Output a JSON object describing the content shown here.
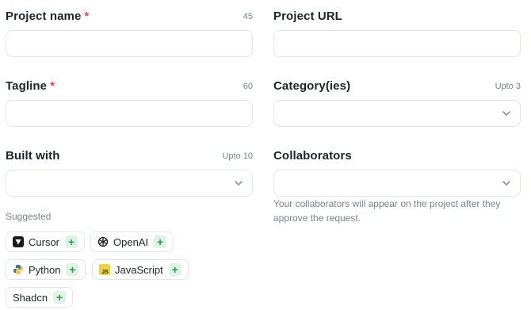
{
  "left": {
    "project_name": {
      "label": "Project name",
      "required_mark": "*",
      "counter": "45",
      "value": ""
    },
    "tagline": {
      "label": "Tagline",
      "required_mark": "*",
      "counter": "60",
      "value": ""
    },
    "built_with": {
      "label": "Built with",
      "limit": "Upto 10",
      "value": ""
    },
    "suggested": {
      "title": "Suggested",
      "chips": [
        {
          "label": "Cursor",
          "icon": "cursor-logo-icon"
        },
        {
          "label": "OpenAI",
          "icon": "openai-logo-icon"
        },
        {
          "label": "Python",
          "icon": "python-logo-icon"
        },
        {
          "label": "JavaScript",
          "icon": "javascript-logo-icon"
        },
        {
          "label": "Shadcn",
          "icon": ""
        }
      ],
      "add_icon": "plus-icon",
      "add_color": "#22a04b"
    }
  },
  "right": {
    "project_url": {
      "label": "Project URL",
      "value": ""
    },
    "categories": {
      "label": "Category(ies)",
      "limit": "Upto 3",
      "value": ""
    },
    "collaborators": {
      "label": "Collaborators",
      "value": "",
      "helper": "Your collaborators will appear on the project after they approve the request."
    }
  },
  "colors": {
    "required": "#ef4444",
    "border": "#e3e6ec",
    "muted": "#7b8190"
  }
}
